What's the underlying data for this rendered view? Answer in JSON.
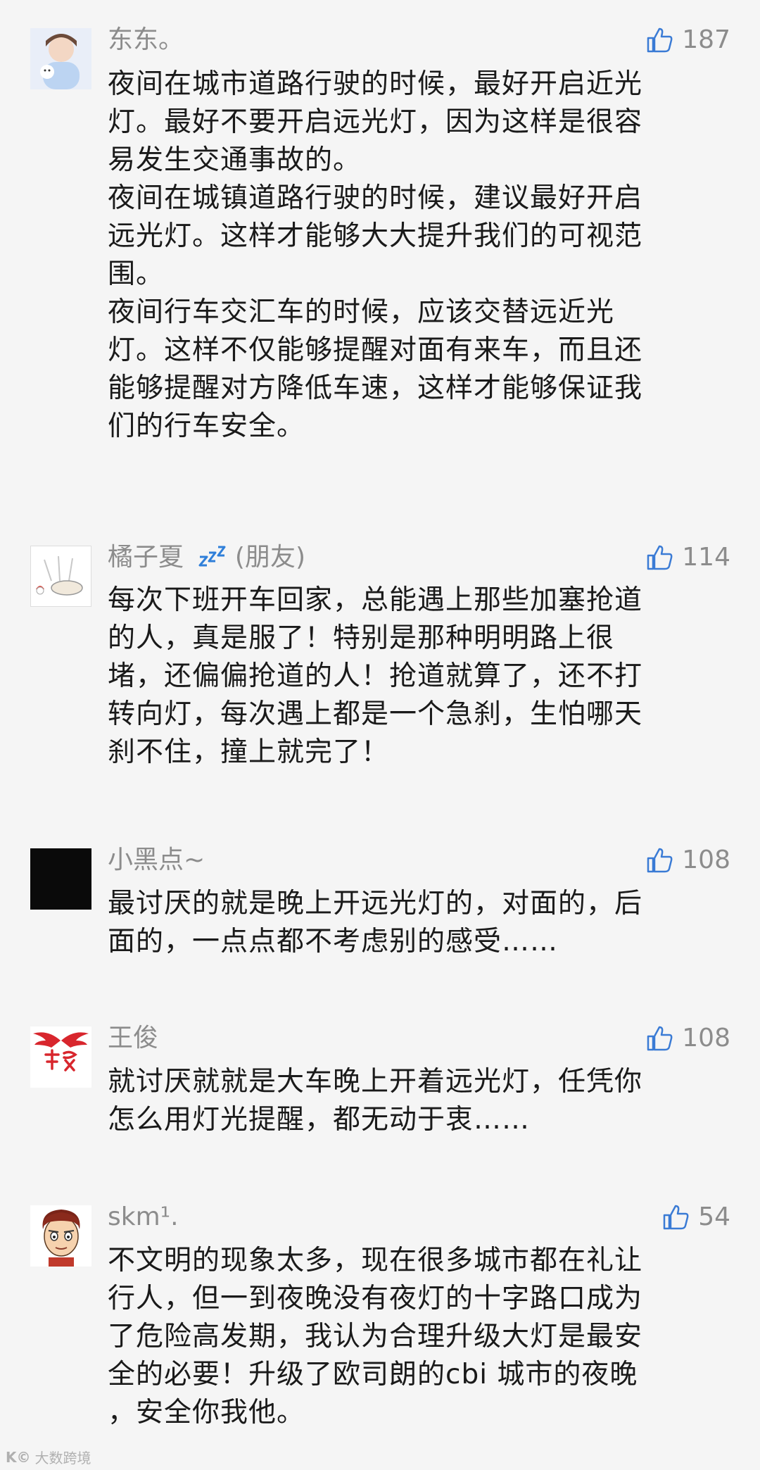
{
  "comments": [
    {
      "username": "东东。",
      "likes": "187",
      "avatar_icon": "cartoon-boy-avatar-icon",
      "lines": [
        "夜间在城市道路行驶的时候，最好开启近光",
        "灯。最好不要开启远光灯，因为这样是很容",
        "易发生交通事故的。",
        "夜间在城镇道路行驶的时候，建议最好开启",
        "远光灯。这样才能够大大提升我们的可视范",
        "围。",
        "夜间行车交汇车的时候，应该交替远近光",
        "灯。这样不仅能够提醒对面有来车，而且还",
        "能够提醒对方降低车速，这样才能够保证我",
        "们的行车安全。"
      ]
    },
    {
      "username": "橘子夏",
      "badge_icon": "zzz-sleep-icon",
      "relation": "(朋友)",
      "likes": "114",
      "avatar_icon": "sketch-avatar-icon",
      "lines": [
        "每次下班开车回家，总能遇上那些加塞抢道",
        "的人，真是服了！特别是那种明明路上很",
        "堵，还偏偏抢道的人！抢道就算了，还不打",
        "转向灯，每次遇上都是一个急刹，生怕哪天",
        "刹不住，撞上就完了！"
      ]
    },
    {
      "username": "小黑点~",
      "likes": "108",
      "avatar_icon": "black-square-avatar-icon",
      "lines": [
        "最讨厌的就是晚上开远光灯的，对面的，后",
        "面的，一点点都不考虑别的感受……"
      ]
    },
    {
      "username": "王俊",
      "likes": "108",
      "avatar_icon": "winged-dream-logo-avatar-icon",
      "avatar_text": "梦想",
      "lines": [
        "就讨厌就就是大车晚上开着远光灯，任凭你",
        "怎么用灯光提醒，都无动于衷……"
      ]
    },
    {
      "username": "skm¹.",
      "likes": "54",
      "avatar_icon": "cartoon-man-avatar-icon",
      "lines": [
        "不文明的现象太多，现在很多城市都在礼让",
        "行人，但一到夜晚没有夜灯的十字路口成为",
        "了危险高发期，我认为合理升级大灯是最安",
        "全的必要！升级了欧司朗的cbi  城市的夜晚",
        "，安全你我他。"
      ]
    }
  ],
  "watermark": {
    "logo": "K©",
    "text": "大数跨境"
  },
  "colors": {
    "background": "#f5f5f5",
    "username": "#8c8c8c",
    "body_text": "#1a1a1a",
    "like_icon": "#3a7bd5"
  }
}
